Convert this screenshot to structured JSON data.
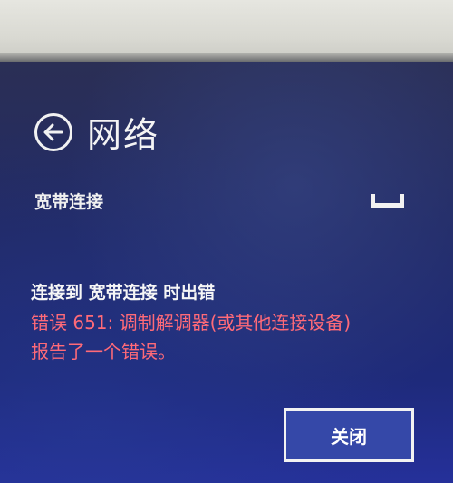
{
  "header": {
    "title": "网络",
    "back_icon": "back-arrow-icon"
  },
  "connection": {
    "name": "宽带连接",
    "icon": "broadband-connection-icon"
  },
  "error": {
    "title": "连接到 宽带连接 时出错",
    "line1": "错误 651: 调制解调器(或其他连接设备)",
    "line2": "报告了一个错误。",
    "color": "#ff6a78"
  },
  "actions": {
    "close_label": "关闭"
  },
  "colors": {
    "panel_background": "#212a66",
    "text": "#f4f4f4"
  }
}
